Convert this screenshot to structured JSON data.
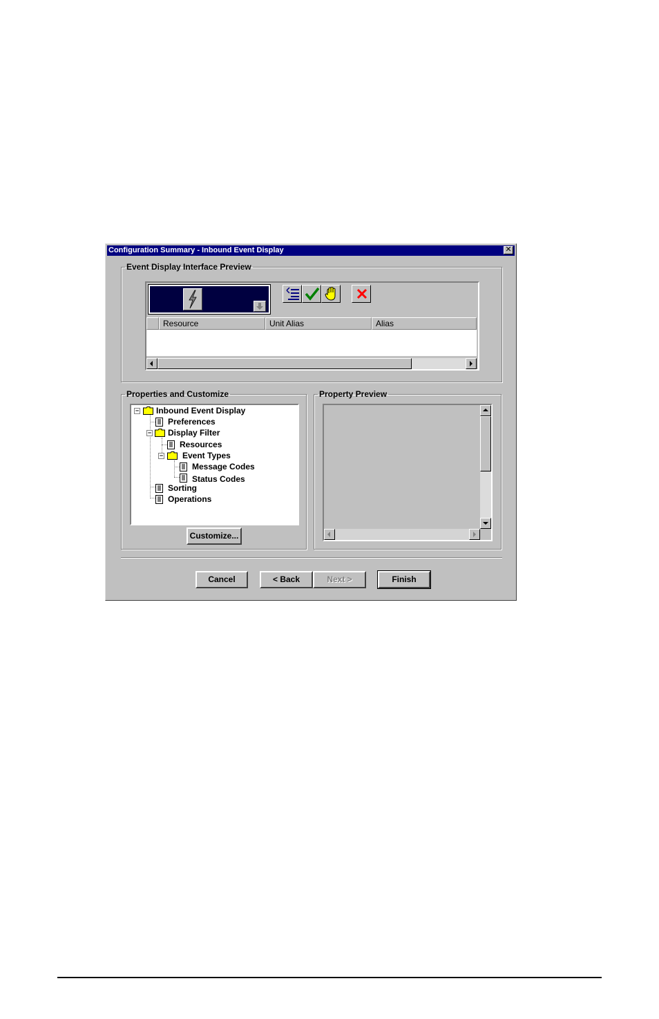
{
  "window": {
    "title": "Configuration Summary - Inbound Event  Display",
    "close_glyph": "✕"
  },
  "preview_group": {
    "legend": "Event Display Interface Preview",
    "toolbar_icons": [
      "select-list-icon",
      "checkmark-icon",
      "hand-icon",
      "delete-x-icon"
    ],
    "columns": [
      "",
      "Resource",
      "Unit Alias",
      "Alias"
    ]
  },
  "properties_group": {
    "legend": "Properties and Customize",
    "tree": [
      {
        "label": "Inbound Event  Display",
        "type": "folder",
        "level": 0,
        "expanded": true
      },
      {
        "label": "Preferences",
        "type": "document",
        "level": 1
      },
      {
        "label": "Display Filter",
        "type": "folder",
        "level": 1,
        "expanded": true
      },
      {
        "label": "Resources",
        "type": "document",
        "level": 2
      },
      {
        "label": "Event Types",
        "type": "folder",
        "level": 2,
        "expanded": true
      },
      {
        "label": "Message Codes",
        "type": "document",
        "level": 3
      },
      {
        "label": "Status Codes",
        "type": "document",
        "level": 3
      },
      {
        "label": "Sorting",
        "type": "document",
        "level": 1
      },
      {
        "label": "Operations",
        "type": "document",
        "level": 1
      }
    ],
    "customize_label": "Customize..."
  },
  "property_preview_group": {
    "legend": "Property Preview"
  },
  "buttons": {
    "cancel": "Cancel",
    "back": "< Back",
    "next": "Next >",
    "finish": "Finish"
  },
  "colors": {
    "title_bar": "#000080",
    "dialog_face": "#c0c0c0",
    "preview_panel": "#000040",
    "folder": "#ffff00"
  }
}
